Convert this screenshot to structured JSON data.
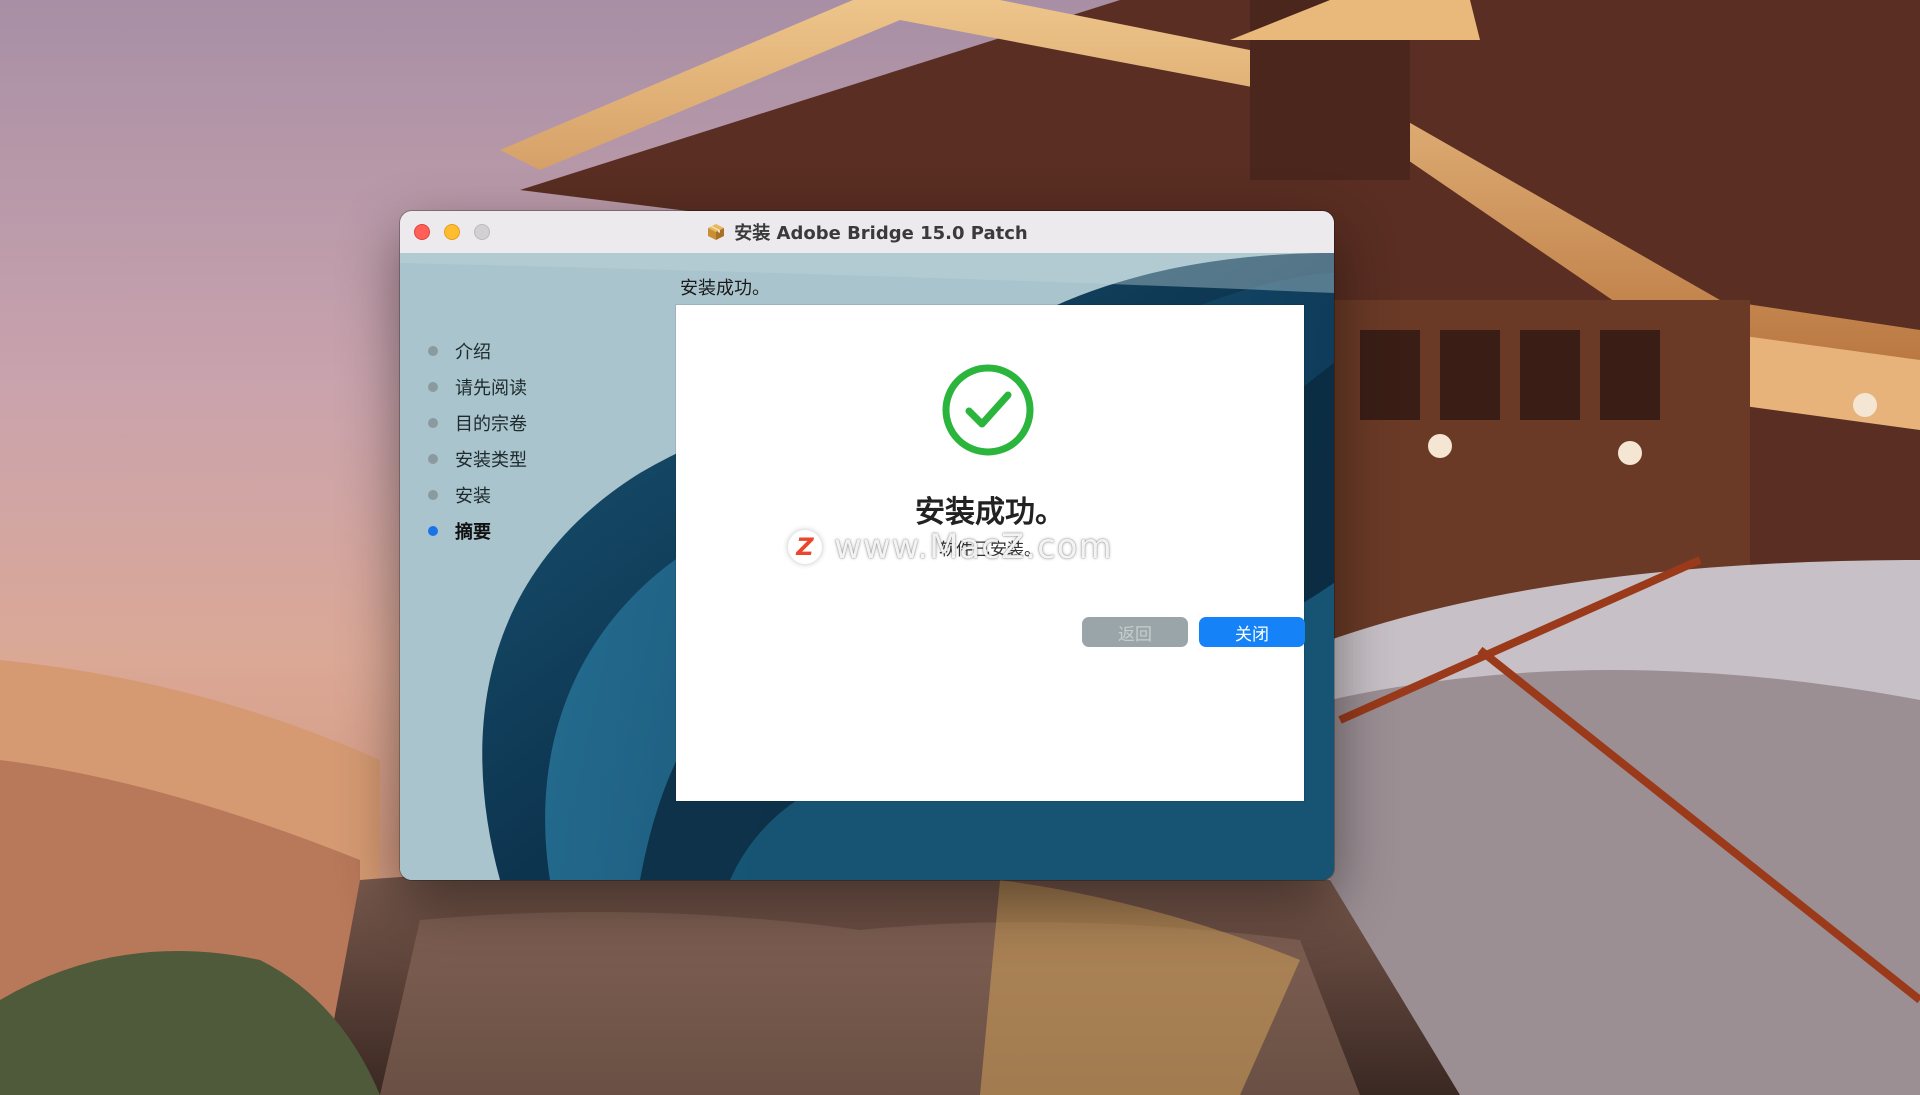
{
  "window": {
    "title": "安装 Adobe Bridge 15.0 Patch"
  },
  "sidebar": {
    "steps": [
      {
        "label": "介绍",
        "active": false
      },
      {
        "label": "请先阅读",
        "active": false
      },
      {
        "label": "目的宗卷",
        "active": false
      },
      {
        "label": "安装类型",
        "active": false
      },
      {
        "label": "安装",
        "active": false
      },
      {
        "label": "摘要",
        "active": true
      }
    ]
  },
  "main": {
    "header": "安装成功。",
    "success_title": "安装成功。",
    "success_subtitle": "软件已安装。",
    "watermark_text": "www.MacZ.com",
    "watermark_logo": "Z"
  },
  "buttons": {
    "back_label": "返回",
    "close_label": "关闭"
  },
  "colors": {
    "accent": "#1583f7",
    "success_green": "#2bb53c",
    "active_step_dot": "#1a73e8"
  }
}
